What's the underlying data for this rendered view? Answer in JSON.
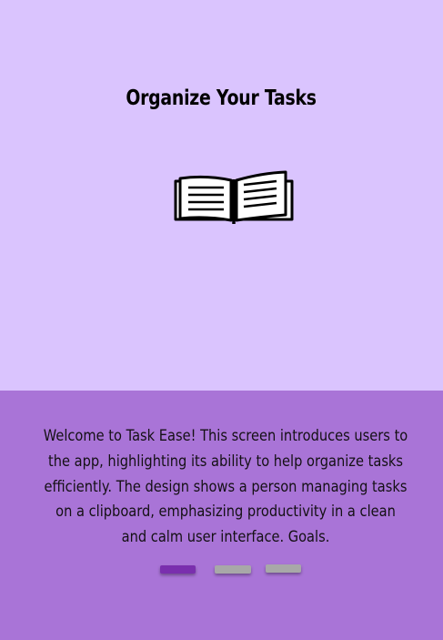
{
  "onboarding": {
    "title": "Organize Your Tasks",
    "illustration_icon": "open-book-icon",
    "description": "Welcome to Task Ease! This screen introduces users to the app, highlighting its ability to help organize tasks efficiently. The design shows a person managing tasks on a clipboard, emphasizing productivity in a clean and calm user interface. Goals.",
    "pager": {
      "total_pages": 3,
      "active_page": 1
    }
  },
  "colors": {
    "top_background": "#dac4fe",
    "bottom_background": "#a974d7",
    "active_indicator": "#7a2fae",
    "inactive_indicator": "#a8a8a8",
    "title_text": "#000000",
    "body_text": "#141014"
  }
}
